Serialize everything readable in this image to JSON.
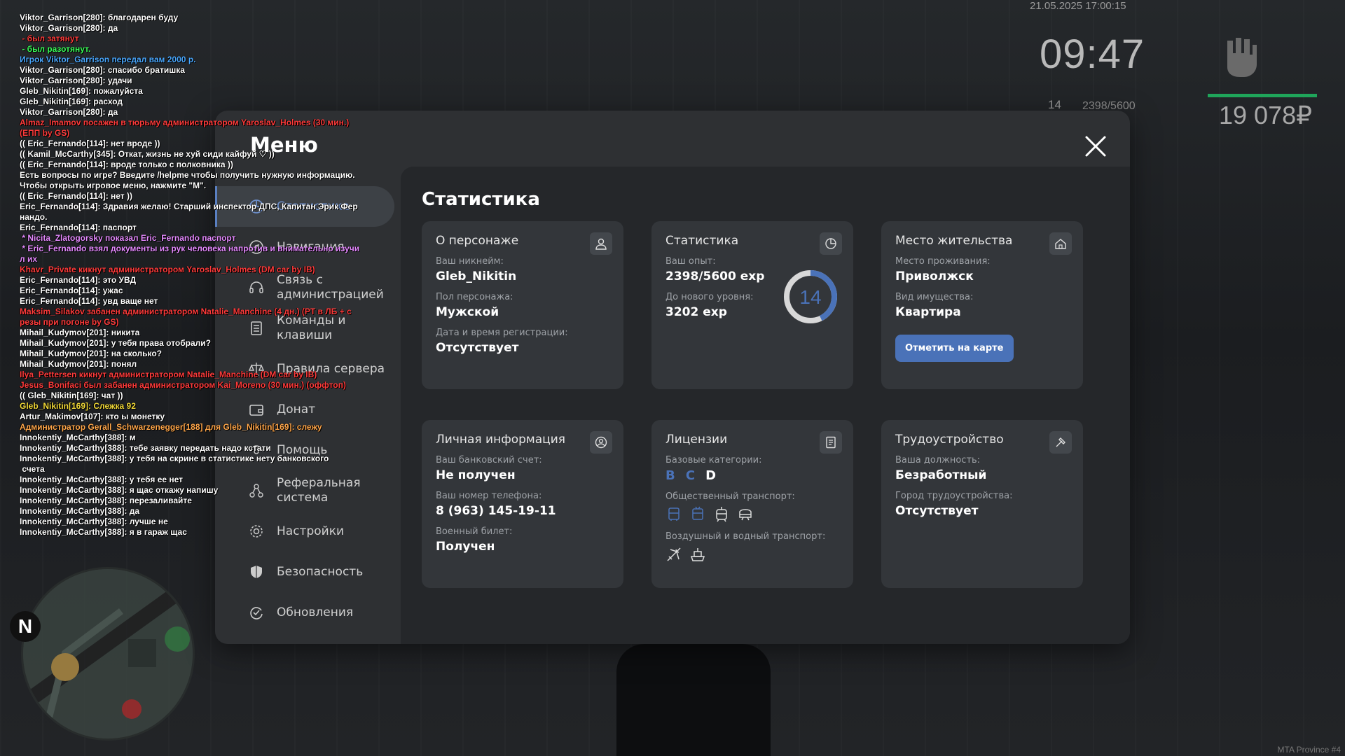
{
  "hud": {
    "datetime": "21.05.2025 17:00:15",
    "time": "09:47",
    "level": "14",
    "exp": "2398/5600",
    "money": "19 078₽",
    "watermark": "MTA Province #4",
    "radar_north": "N"
  },
  "chat": [
    {
      "text": "Viktor_Garrison[280]: благодарен буду",
      "color": "#ffffff"
    },
    {
      "text": "Viktor_Garrison[280]: да",
      "color": "#ffffff"
    },
    {
      "text": " - был затянут",
      "color": "#ff3b3b"
    },
    {
      "text": " - был разотянут.",
      "color": "#3bff5a"
    },
    {
      "text": "Игрок Viktor_Garrison передал вам 2000 р.",
      "color": "#4aa8ff"
    },
    {
      "text": "Viktor_Garrison[280]: спасибо братишка",
      "color": "#ffffff"
    },
    {
      "text": "Viktor_Garrison[280]: удачи",
      "color": "#ffffff"
    },
    {
      "text": "Gleb_Nikitin[169]: пожалуйста",
      "color": "#ffffff"
    },
    {
      "text": "Gleb_Nikitin[169]: расход",
      "color": "#ffffff"
    },
    {
      "text": "Viktor_Garrison[280]: да",
      "color": "#ffffff"
    },
    {
      "text": "Almaz_Imamov посажен в тюрьму администратором Yaroslav_Holmes (30 мин.)",
      "color": "#ff3b3b"
    },
    {
      "text": "(ЕПП by GS)",
      "color": "#ff3b3b"
    },
    {
      "text": "(( Eric_Fernando[114]: нет вроде ))",
      "color": "#ffffff"
    },
    {
      "text": "(( Kamil_McCarthy[345]: Откат, жизнь не хуй сиди кайфуй ♡ ))",
      "color": "#ffffff"
    },
    {
      "text": "(( Eric_Fernando[114]: вроде только с полковника ))",
      "color": "#ffffff"
    },
    {
      "text": "Есть вопросы по игре? Введите /helpme чтобы получить нужную информацию.",
      "color": "#ffffff"
    },
    {
      "text": "Чтобы открыть игровое меню, нажмите \"M\".",
      "color": "#ffffff"
    },
    {
      "text": "(( Eric_Fernando[114]: нет ))",
      "color": "#ffffff"
    },
    {
      "text": "Eric_Fernando[114]: Здравия желаю! Старший инспектор ДПС, Капитан Эрик Фер",
      "color": "#ffffff"
    },
    {
      "text": "нандо.",
      "color": "#ffffff"
    },
    {
      "text": "Eric_Fernando[114]: паспорт",
      "color": "#ffffff"
    },
    {
      "text": " * Nicita_Zlatogorsky показал Eric_Fernando паспорт",
      "color": "#e58aff"
    },
    {
      "text": " * Eric_Fernando взял документы из рук человека напротив и внимательно изучи",
      "color": "#e58aff"
    },
    {
      "text": "л их",
      "color": "#e58aff"
    },
    {
      "text": "Khavr_Private кикнут администратором Yaroslav_Holmes (DM car by IB)",
      "color": "#ff3b3b"
    },
    {
      "text": "Eric_Fernando[114]: это УВД",
      "color": "#ffffff"
    },
    {
      "text": "Eric_Fernando[114]: ужас",
      "color": "#ffffff"
    },
    {
      "text": "Eric_Fernando[114]: увд ваще нет",
      "color": "#ffffff"
    },
    {
      "text": "Maksim_Silakov забанен администратором Natalie_Manchine (4 дн.) (PT в ЛБ + с",
      "color": "#ff3b3b"
    },
    {
      "text": "резы при погоне by GS)",
      "color": "#ff3b3b"
    },
    {
      "text": "Mihail_Kudymov[201]: никита",
      "color": "#ffffff"
    },
    {
      "text": "Mihail_Kudymov[201]: у тебя права отобрали?",
      "color": "#ffffff"
    },
    {
      "text": "Mihail_Kudymov[201]: на сколько?",
      "color": "#ffffff"
    },
    {
      "text": "Mihail_Kudymov[201]: понял",
      "color": "#ffffff"
    },
    {
      "text": "Ilya_Pettersen кикнут администратором Natalie_Manchine (DM car by IB)",
      "color": "#ff3b3b"
    },
    {
      "text": "Jesus_Bonifaci был забанен администратором Kai_Moreno (30 мин.) (оффтоп)",
      "color": "#ff3b3b"
    },
    {
      "text": "(( Gleb_Nikitin[169]: чат ))",
      "color": "#ffffff"
    },
    {
      "text": "Gleb_Nikitin[169]: Слежка 92",
      "color": "#f0d838"
    },
    {
      "text": "Artur_Makimov[107]: кто ы монетку",
      "color": "#ffffff"
    },
    {
      "text": "Администратор Gerall_Schwarzenegger[188] для Gleb_Nikitin[169]: слежу",
      "color": "#ffa64a"
    },
    {
      "text": "Innokentiy_McCarthy[388]: м",
      "color": "#ffffff"
    },
    {
      "text": "Innokentiy_McCarthy[388]: тебе заявку передать надо кстати",
      "color": "#ffffff"
    },
    {
      "text": "Innokentiy_McCarthy[388]: у тебя на скрине в статистике нету банковского",
      "color": "#ffffff"
    },
    {
      "text": " счета",
      "color": "#ffffff"
    },
    {
      "text": "Innokentiy_McCarthy[388]: у тебя ее нет",
      "color": "#ffffff"
    },
    {
      "text": "Innokentiy_McCarthy[388]: я щас откажу напишу",
      "color": "#ffffff"
    },
    {
      "text": "Innokentiy_McCarthy[388]: перезаливайте",
      "color": "#ffffff"
    },
    {
      "text": "Innokentiy_McCarthy[388]: да",
      "color": "#ffffff"
    },
    {
      "text": "Innokentiy_McCarthy[388]: лучше не",
      "color": "#ffffff"
    },
    {
      "text": "Innokentiy_McCarthy[388]: я в гараж щас",
      "color": "#ffffff"
    }
  ],
  "menu": {
    "title": "Меню",
    "items": [
      {
        "label": "Статистика",
        "active": true,
        "icon": "stats-icon"
      },
      {
        "label": "Навигация",
        "active": false,
        "icon": "compass-icon"
      },
      {
        "label": "Связь с администрацией",
        "active": false,
        "icon": "headset-icon"
      },
      {
        "label": "Команды и клавиши",
        "active": false,
        "icon": "document-icon"
      },
      {
        "label": "Правила сервера",
        "active": false,
        "icon": "scales-icon"
      },
      {
        "label": "Донат",
        "active": false,
        "icon": "wallet-icon"
      },
      {
        "label": "Помощь",
        "active": false,
        "icon": "help-icon"
      },
      {
        "label": "Реферальная система",
        "active": false,
        "icon": "referral-icon"
      },
      {
        "label": "Настройки",
        "active": false,
        "icon": "gear-icon"
      },
      {
        "label": "Безопасность",
        "active": false,
        "icon": "shield-icon"
      },
      {
        "label": "Обновления",
        "active": false,
        "icon": "update-icon"
      }
    ]
  },
  "stats": {
    "title": "Статистика",
    "character": {
      "title": "О персонаже",
      "nick_label": "Ваш никнейм:",
      "nick": "Gleb_Nikitin",
      "gender_label": "Пол персонажа:",
      "gender": "Мужской",
      "reg_label": "Дата и время регистрации:",
      "reg": "Отсутствует"
    },
    "statistics": {
      "title": "Статистика",
      "exp_label": "Ваш опыт:",
      "exp": "2398/5600 exp",
      "next_label": "До нового уровня:",
      "next": "3202 exp",
      "level": "14",
      "progress": 0.428
    },
    "residence": {
      "title": "Место жительства",
      "place_label": "Место проживания:",
      "place": "Приволжск",
      "type_label": "Вид имущества:",
      "type": "Квартира",
      "button": "Отметить на карте"
    },
    "personal": {
      "title": "Личная информация",
      "bank_label": "Ваш банковский счет:",
      "bank": "Не получен",
      "phone_label": "Ваш номер телефона:",
      "phone": "8 (963) 145-19-11",
      "military_label": "Военный билет:",
      "military": "Получен"
    },
    "licenses": {
      "title": "Лицензии",
      "base_label": "Базовые категории:",
      "cat_b": "B",
      "cat_c": "C",
      "cat_d": "D",
      "public_label": "Общественный транспорт:",
      "air_label": "Воздушный и водный транспорт:"
    },
    "job": {
      "title": "Трудоустройство",
      "position_label": "Ваша должность:",
      "position": "Безработный",
      "city_label": "Город трудоустройства:",
      "city": "Отсутствует"
    }
  },
  "colors": {
    "accent": "#4a72b8",
    "active_nav": "#6d8fcc",
    "category_owned": "#ffffff",
    "category_missing": "#4a72b8"
  }
}
